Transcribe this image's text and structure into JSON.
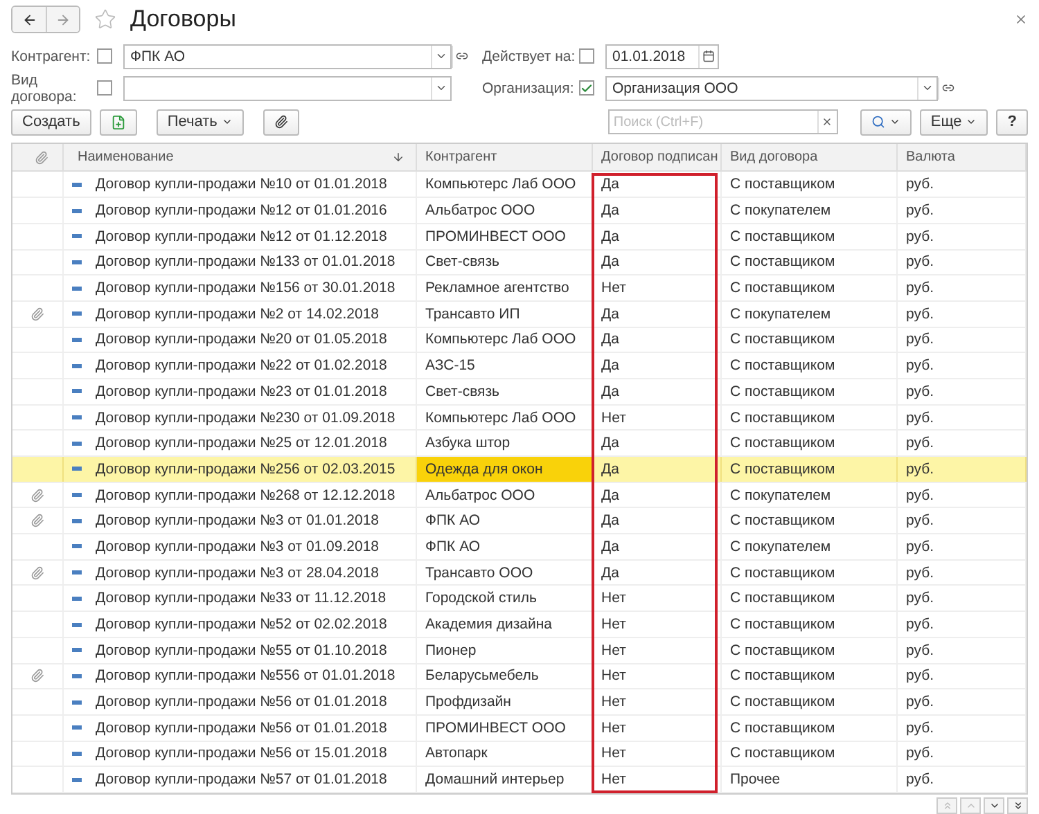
{
  "window": {
    "title": "Договоры",
    "favorite": false
  },
  "filters": [
    {
      "label": "Контрагент:",
      "checked": false,
      "value": "ФПК АО",
      "kind": "select"
    },
    {
      "label": "Действует на:",
      "checked": false,
      "value": "01.01.2018",
      "kind": "date"
    },
    {
      "label": "Вид договора:",
      "checked": false,
      "kind": "select-plain"
    },
    {
      "label": "Организация:",
      "checked": true,
      "value": "Организация ООО",
      "kind": "select"
    }
  ],
  "toolbar": {
    "create": "Создать",
    "print": "Печать",
    "search": {
      "placeholder": "Поиск (Ctrl+F)"
    },
    "more": "Еще",
    "help": "?"
  },
  "table": {
    "columns": [
      {
        "label": "Наименование",
        "kind": "name",
        "highlighted": false
      },
      {
        "label": "Контрагент",
        "kind": "text",
        "highlighted": false
      },
      {
        "label": "Договор подписан",
        "kind": "text",
        "highlighted": true
      },
      {
        "label": "Вид договора",
        "kind": "text",
        "highlighted": false
      },
      {
        "label": "Валюта",
        "kind": "text",
        "highlighted": false
      }
    ],
    "rows": [
      {
        "attached": false,
        "selected": false,
        "cells": [
          "Договор купли-продажи №10 от 01.01.2018",
          "Компьютерс Лаб ООО",
          "Да",
          "С поставщиком",
          "руб."
        ]
      },
      {
        "attached": false,
        "selected": false,
        "cells": [
          "Договор купли-продажи №12 от 01.01.2016",
          "Альбатрос ООО",
          "Да",
          "С покупателем",
          "руб."
        ]
      },
      {
        "attached": false,
        "selected": false,
        "cells": [
          "Договор купли-продажи №12 от 01.12.2018",
          "ПРОМИНВЕСТ ООО",
          "Да",
          "С поставщиком",
          "руб."
        ]
      },
      {
        "attached": false,
        "selected": false,
        "cells": [
          "Договор купли-продажи №133 от 01.01.2018",
          "Свет-связь",
          "Да",
          "С поставщиком",
          "руб."
        ]
      },
      {
        "attached": false,
        "selected": false,
        "cells": [
          "Договор купли-продажи №156 от 30.01.2018",
          "Рекламное агентство",
          "Нет",
          "С поставщиком",
          "руб."
        ]
      },
      {
        "attached": true,
        "selected": false,
        "cells": [
          "Договор купли-продажи №2 от 14.02.2018",
          "Трансавто ИП",
          "Да",
          "С покупателем",
          "руб."
        ]
      },
      {
        "attached": false,
        "selected": false,
        "cells": [
          "Договор купли-продажи №20 от 01.05.2018",
          "Компьютерс Лаб ООО",
          "Да",
          "С поставщиком",
          "руб."
        ]
      },
      {
        "attached": false,
        "selected": false,
        "cells": [
          "Договор купли-продажи №22 от 01.02.2018",
          "АЗС-15",
          "Да",
          "С поставщиком",
          "руб."
        ]
      },
      {
        "attached": false,
        "selected": false,
        "cells": [
          "Договор купли-продажи №23 от 01.01.2018",
          "Свет-связь",
          "Да",
          "С поставщиком",
          "руб."
        ]
      },
      {
        "attached": false,
        "selected": false,
        "cells": [
          "Договор купли-продажи №230 от 01.09.2018",
          "Компьютерс Лаб ООО",
          "Нет",
          "С поставщиком",
          "руб."
        ]
      },
      {
        "attached": false,
        "selected": false,
        "cells": [
          "Договор купли-продажи №25 от 12.01.2018",
          "Азбука штор",
          "Да",
          "С поставщиком",
          "руб."
        ]
      },
      {
        "attached": false,
        "selected": true,
        "cells": [
          "Договор купли-продажи №256 от 02.03.2015",
          "Одежда для окон",
          "Да",
          "С поставщиком",
          "руб."
        ]
      },
      {
        "attached": true,
        "selected": false,
        "cells": [
          "Договор купли-продажи №268 от 12.12.2018",
          "Альбатрос ООО",
          "Да",
          "С покупателем",
          "руб."
        ]
      },
      {
        "attached": true,
        "selected": false,
        "cells": [
          "Договор купли-продажи №3 от 01.01.2018",
          "ФПК АО",
          "Да",
          "С поставщиком",
          "руб."
        ]
      },
      {
        "attached": false,
        "selected": false,
        "cells": [
          "Договор купли-продажи №3 от 01.09.2018",
          "ФПК АО",
          "Да",
          "С покупателем",
          "руб."
        ]
      },
      {
        "attached": true,
        "selected": false,
        "cells": [
          "Договор купли-продажи №3 от 28.04.2018",
          "Трансавто ООО",
          "Да",
          "С поставщиком",
          "руб."
        ]
      },
      {
        "attached": false,
        "selected": false,
        "cells": [
          "Договор купли-продажи №33 от 11.12.2018",
          "Городской стиль",
          "Нет",
          "С поставщиком",
          "руб."
        ]
      },
      {
        "attached": false,
        "selected": false,
        "cells": [
          "Договор купли-продажи №52 от 02.02.2018",
          "Академия дизайна",
          "Нет",
          "С поставщиком",
          "руб."
        ]
      },
      {
        "attached": false,
        "selected": false,
        "cells": [
          "Договор купли-продажи №55 от 01.10.2018",
          "Пионер",
          "Нет",
          "С поставщиком",
          "руб."
        ]
      },
      {
        "attached": true,
        "selected": false,
        "cells": [
          "Договор купли-продажи №556 от 01.01.2018",
          "Беларусьмебель",
          "Нет",
          "С поставщиком",
          "руб."
        ]
      },
      {
        "attached": false,
        "selected": false,
        "cells": [
          "Договор купли-продажи №56 от 01.01.2018",
          "Профдизайн",
          "Нет",
          "С поставщиком",
          "руб."
        ]
      },
      {
        "attached": false,
        "selected": false,
        "cells": [
          "Договор купли-продажи №56 от 01.01.2018",
          "ПРОМИНВЕСТ ООО",
          "Нет",
          "С поставщиком",
          "руб."
        ]
      },
      {
        "attached": false,
        "selected": false,
        "cells": [
          "Договор купли-продажи №56 от 15.01.2018",
          "Автопарк",
          "Нет",
          "С поставщиком",
          "руб."
        ]
      },
      {
        "attached": false,
        "selected": false,
        "cells": [
          "Договор купли-продажи №57 от 01.01.2018",
          "Домашний интерьер",
          "Нет",
          "Прочее",
          "руб."
        ]
      }
    ]
  }
}
